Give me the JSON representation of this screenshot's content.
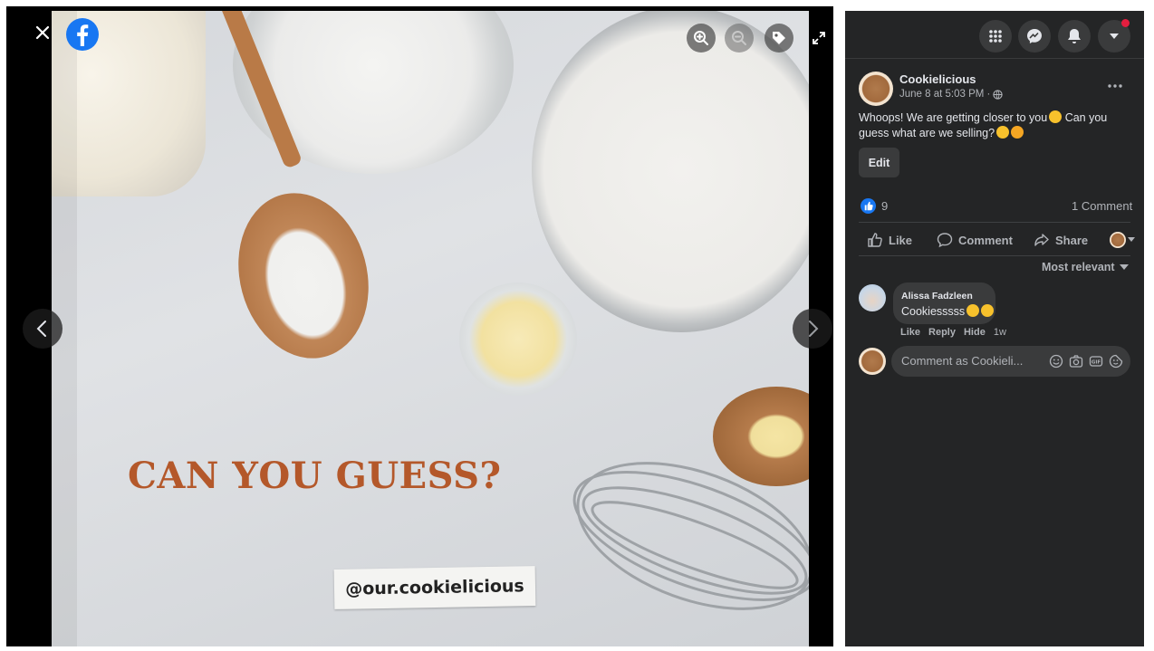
{
  "viewer": {
    "close_icon": "close-icon",
    "logo_icon": "facebook-logo-icon",
    "zoom_in_icon": "zoom-in-icon",
    "zoom_out_icon": "zoom-out-icon",
    "tag_icon": "tag-icon",
    "fullscreen_icon": "fullscreen-icon",
    "prev_icon": "chevron-left-icon",
    "next_icon": "chevron-right-icon",
    "photo": {
      "headline": "CAN YOU GUESS?",
      "handle": "@our.cookielicious",
      "headline_color": "#b4582a"
    }
  },
  "header": {
    "menu_icon": "menu-grid-icon",
    "messenger_icon": "messenger-icon",
    "notifications_icon": "bell-icon",
    "account_icon": "caret-down-icon",
    "notification_dot_color": "#e41e3f"
  },
  "post": {
    "author": "Cookielicious",
    "timestamp": "June 8 at 5:03 PM ·",
    "audience_icon": "globe-icon",
    "more_icon": "ellipsis-icon",
    "text_line1": "Whoops! We are getting closer to you",
    "text_line1_after": " Can you",
    "text_line2": "guess what are we selling?",
    "edit_label": "Edit",
    "like_count": "9",
    "comment_count": "1 Comment",
    "actions": {
      "like": "Like",
      "comment": "Comment",
      "share": "Share"
    },
    "sort_label": "Most relevant"
  },
  "comments": [
    {
      "author": "Alissa Fadzleen",
      "text": "Cookiesssss",
      "like": "Like",
      "reply": "Reply",
      "hide": "Hide",
      "time": "1w"
    }
  ],
  "composer": {
    "placeholder": "Comment as Cookieli...",
    "emoji_icon": "emoji-icon",
    "camera_icon": "camera-icon",
    "gif_icon": "gif-icon",
    "sticker_icon": "sticker-icon"
  },
  "colors": {
    "panel_bg": "#242526",
    "accent": "#1877f2"
  }
}
